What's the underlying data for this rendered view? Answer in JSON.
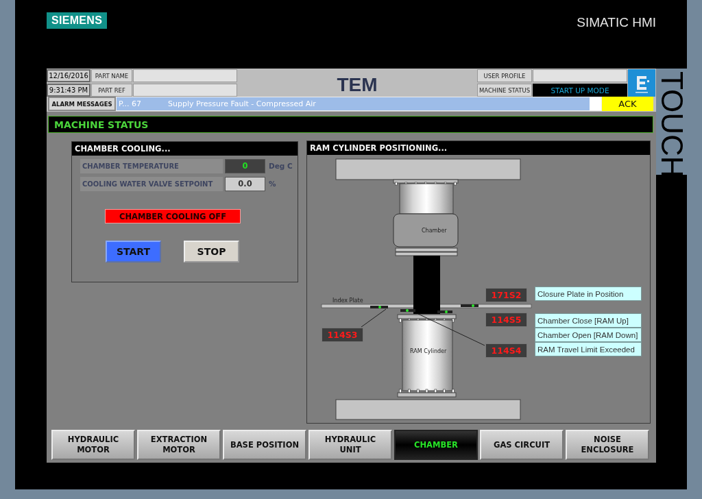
{
  "bezel": {
    "brand": "SIEMENS",
    "product": "SIMATIC HMI",
    "side_label": "TOUCH"
  },
  "header": {
    "date": "12/16/2016",
    "time": "9:31:43 PM",
    "part_name_label": "PART NAME",
    "part_ref_label": "PART REF",
    "title": "TEM",
    "user_profile_label": "USER PROFILE",
    "machine_status_label": "MACHINE STATUS",
    "machine_status": "START UP MODE"
  },
  "alarm": {
    "button": "ALARM MESSAGES",
    "number": "P... 67",
    "message": "Supply Pressure Fault - Compressed Air",
    "ack": "ACK"
  },
  "section_title": "MACHINE STATUS",
  "chamber_cooling": {
    "title": "CHAMBER COOLING...",
    "readings": [
      {
        "label": "CHAMBER TEMPERATURE",
        "value": "0",
        "unit": "Deg C",
        "kind": "display"
      },
      {
        "label": "COOLING WATER VALVE SETPOINT",
        "value": "0.0",
        "unit": "%",
        "kind": "input"
      }
    ],
    "status": "CHAMBER COOLING OFF",
    "buttons": [
      {
        "label": "START",
        "kind": "primary"
      },
      {
        "label": "STOP",
        "kind": "secondary"
      }
    ]
  },
  "ram_positioning": {
    "title": "RAM CYLINDER POSITIONING...",
    "chamber_label": "Chamber",
    "index_plate_label": "Index Plate",
    "ram_cylinder_label": "RAM Cylinder",
    "sensors": [
      "171S2",
      "114S5",
      "114S4",
      "114S3"
    ],
    "legend": [
      "Closure Plate in Position",
      "Chamber Close [RAM Up]",
      "Chamber Open [RAM Down]",
      "RAM Travel Limit Exceeded"
    ]
  },
  "nav": [
    {
      "label": "HYDRAULIC\nMOTOR",
      "selected": false
    },
    {
      "label": "EXTRACTION\nMOTOR",
      "selected": false
    },
    {
      "label": "BASE POSITION",
      "selected": false
    },
    {
      "label": "HYDRAULIC\nUNIT",
      "selected": false
    },
    {
      "label": "CHAMBER",
      "selected": true
    },
    {
      "label": "GAS CIRCUIT",
      "selected": false
    },
    {
      "label": "NOISE\nENCLOSURE",
      "selected": false
    }
  ]
}
